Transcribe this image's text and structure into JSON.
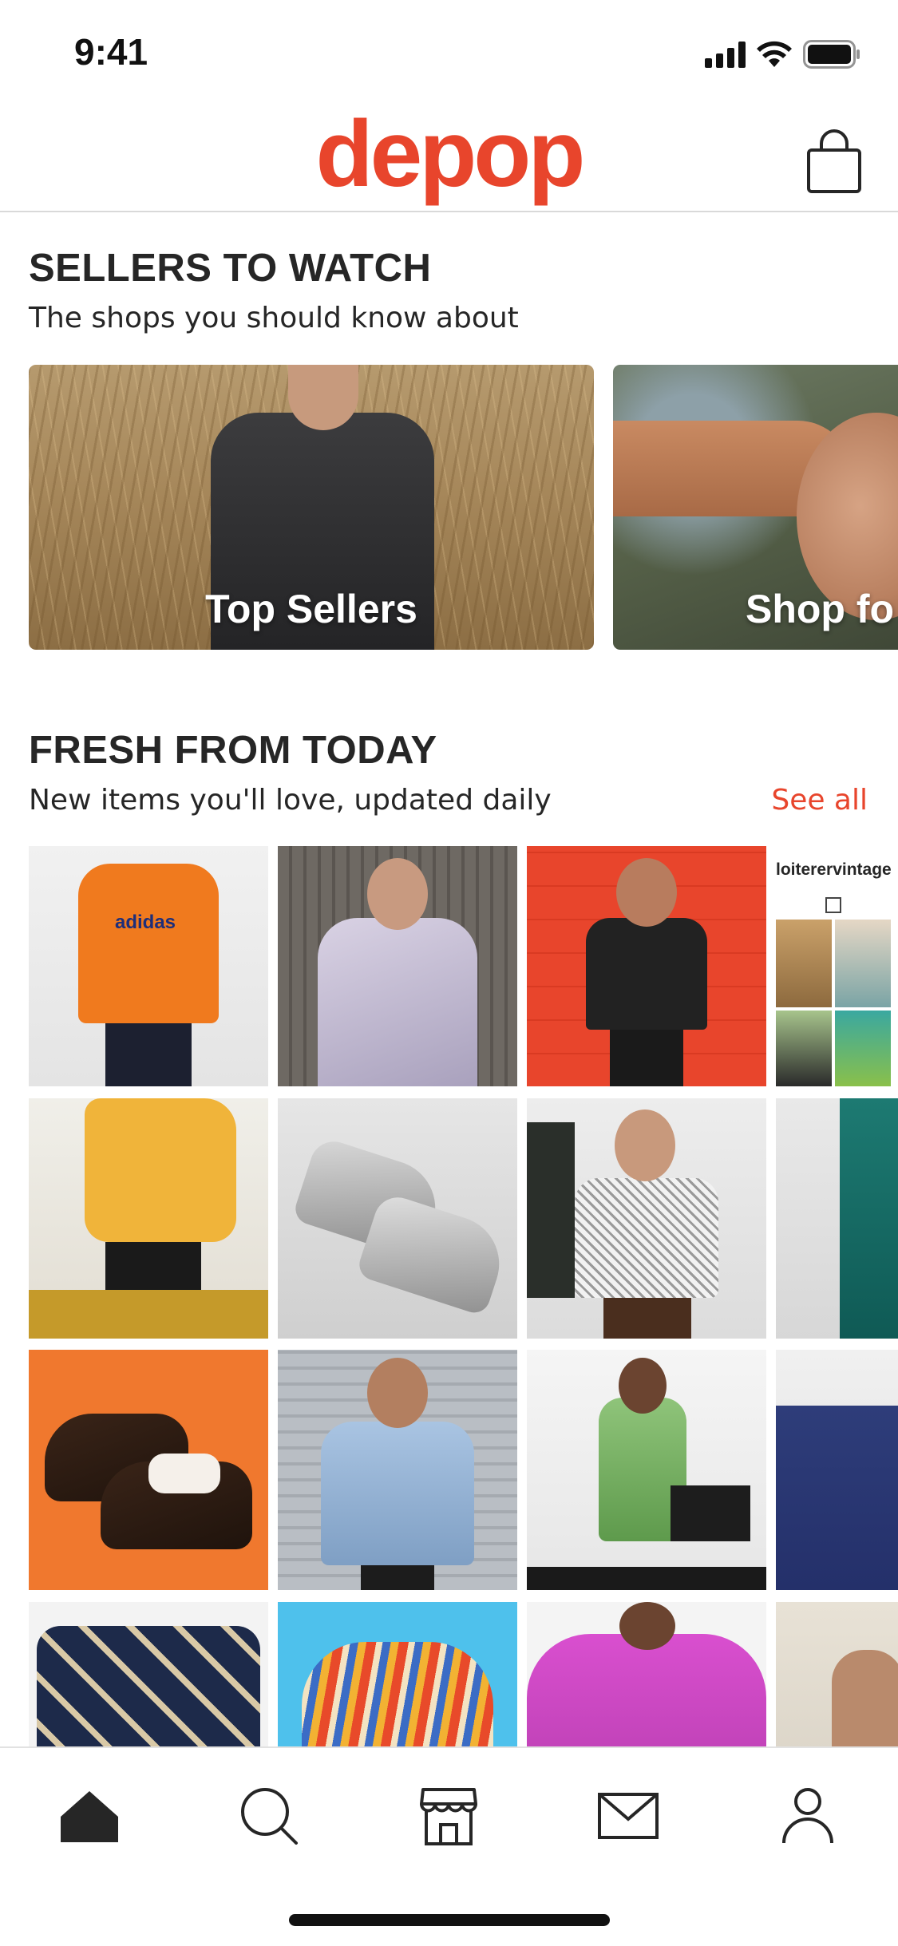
{
  "status_bar": {
    "time": "9:41"
  },
  "header": {
    "logo": "depop"
  },
  "sellers_section": {
    "title": "SELLERS TO WATCH",
    "subtitle": "The shops you should know about",
    "cards": [
      {
        "label": "Top Sellers"
      },
      {
        "label": "Shop fo"
      }
    ]
  },
  "fresh_section": {
    "title": "FRESH FROM TODAY",
    "subtitle": "New items you'll love, updated daily",
    "see_all": "See all",
    "items": [
      {
        "text": "adidas"
      },
      {
        "text": "loiterervintage"
      }
    ]
  },
  "nav": {
    "items": [
      "home-icon",
      "search-icon",
      "shop-icon",
      "messages-icon",
      "profile-icon"
    ],
    "active": "home-icon"
  },
  "colors": {
    "brand": "#e8452c",
    "text": "#262626"
  }
}
